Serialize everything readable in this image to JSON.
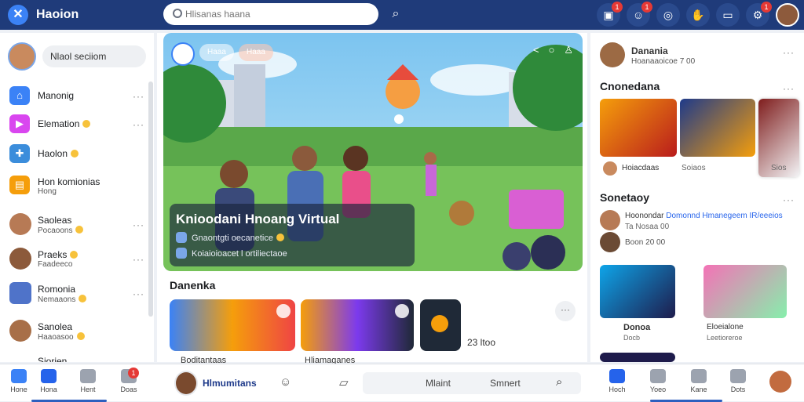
{
  "app": {
    "brand": "Haoion",
    "logo_glyph": "✕",
    "search_placeholder": "Hlisanas haana",
    "accent": "#1f3b7a",
    "top_badges": [
      "1",
      "1",
      "1"
    ]
  },
  "left": {
    "profile_field": "Nlaol seciiom",
    "items": [
      {
        "label": "Manonig",
        "icon": "home-icon"
      },
      {
        "label": "Elemation",
        "icon": "video-icon"
      },
      {
        "label": "Haolon",
        "icon": "controller-icon"
      },
      {
        "label": "Hon komionias",
        "sub": "Hong",
        "icon": "calendar-icon"
      }
    ],
    "contacts": [
      {
        "name": "Saoleas",
        "sub": "Pocaoons"
      },
      {
        "name": "Praeks",
        "sub": "Faadeeco"
      },
      {
        "name": "Romonia",
        "sub": "Nemaaons"
      },
      {
        "name": "Sanolea",
        "sub": "Haaoasoo"
      },
      {
        "name": "Siorien"
      }
    ]
  },
  "hero": {
    "chip1": "Haaa",
    "chip2": "Haaa",
    "title": "Knioodani Hnoang Virtual",
    "line1": "Gnaontgti oecanetice",
    "line2": "Koiaioioacet l ortiliectaoe"
  },
  "center": {
    "section_title": "Danenka",
    "count_label": "23 ltoo",
    "card_captions": [
      "Boditantaas",
      "Hliamaganes"
    ]
  },
  "right": {
    "profile_name": "Danania",
    "profile_sub": "Hoanaaoicoe 7 00",
    "section1": "Cnonedana",
    "card1_label": "Hoiacdaas",
    "card1_meta": "Soiaos",
    "card1_meta2": "Sios",
    "section2": "Sonetaoy",
    "notif1_name": "Hoonondar",
    "notif1_text": "Domonnd Hmanegeem",
    "notif1_tag": "IR/eeeios",
    "notif1_sub1": "Ta",
    "notif1_sub2": "Nosaa",
    "notif1_sub3": "00",
    "notif2_sub": "Boon 20 00",
    "card2_title": "Donoa",
    "card2_sub": "Docb",
    "card3_title": "Eloeialone",
    "card3_sub": "Leetioreroe"
  },
  "bottom": {
    "left_labels": [
      "Hone",
      "Hona",
      "Hent",
      "Doas"
    ],
    "chat_name": "Hlmumitans",
    "chat_placeholder": "Mlaint",
    "chat_send": "Smnert",
    "chat_badge": "1",
    "right_labels": [
      "Hoch",
      "Yoeo",
      "Kane",
      "Dots"
    ]
  }
}
